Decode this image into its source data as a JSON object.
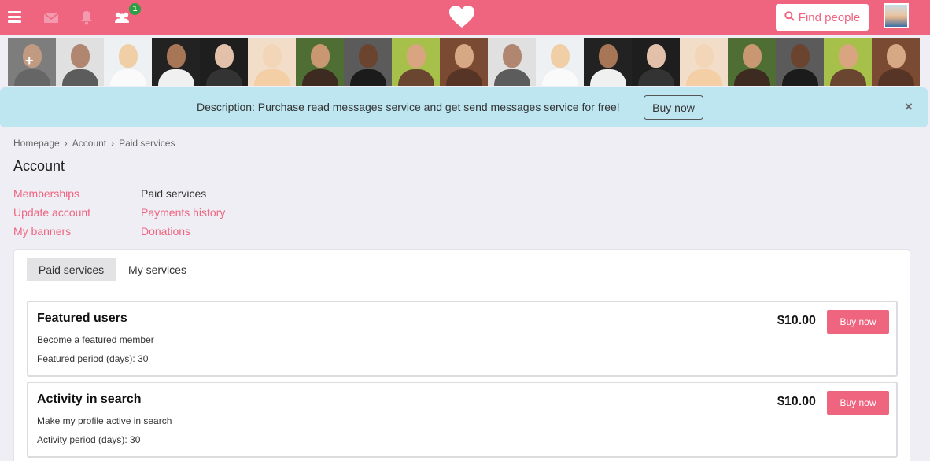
{
  "header": {
    "notifications_badge": "1",
    "find_people_label": "Find people",
    "icons": [
      "menu-icon",
      "envelope-icon",
      "bell-icon",
      "friends-icon",
      "heart-logo-icon",
      "search-icon"
    ]
  },
  "banner": {
    "text": "Description: Purchase read messages service and get send messages service for free!",
    "button_label": "Buy now",
    "close_label": "×"
  },
  "breadcrumb": {
    "items": [
      "Homepage",
      "Account",
      "Paid services"
    ],
    "separator": "›"
  },
  "page": {
    "title": "Account"
  },
  "account_nav": {
    "col1": [
      "Memberships",
      "Update account",
      "My banners"
    ],
    "col2": [
      "Paid services",
      "Payments history",
      "Donations"
    ],
    "active": "Paid services"
  },
  "tabs": {
    "paid_services": "Paid services",
    "my_services": "My services"
  },
  "services": [
    {
      "title": "Featured users",
      "description": "Become a featured member",
      "period": "Featured period (days): 30",
      "price": "$10.00",
      "button": "Buy now"
    },
    {
      "title": "Activity in search",
      "description": "Make my profile active in search",
      "period": "Activity period (days): 30",
      "price": "$10.00",
      "button": "Buy now"
    }
  ],
  "colors": {
    "brand": "#ef6580",
    "banner_bg": "#bde6f1",
    "page_bg": "#efeef4",
    "badge": "#2f9e44"
  }
}
